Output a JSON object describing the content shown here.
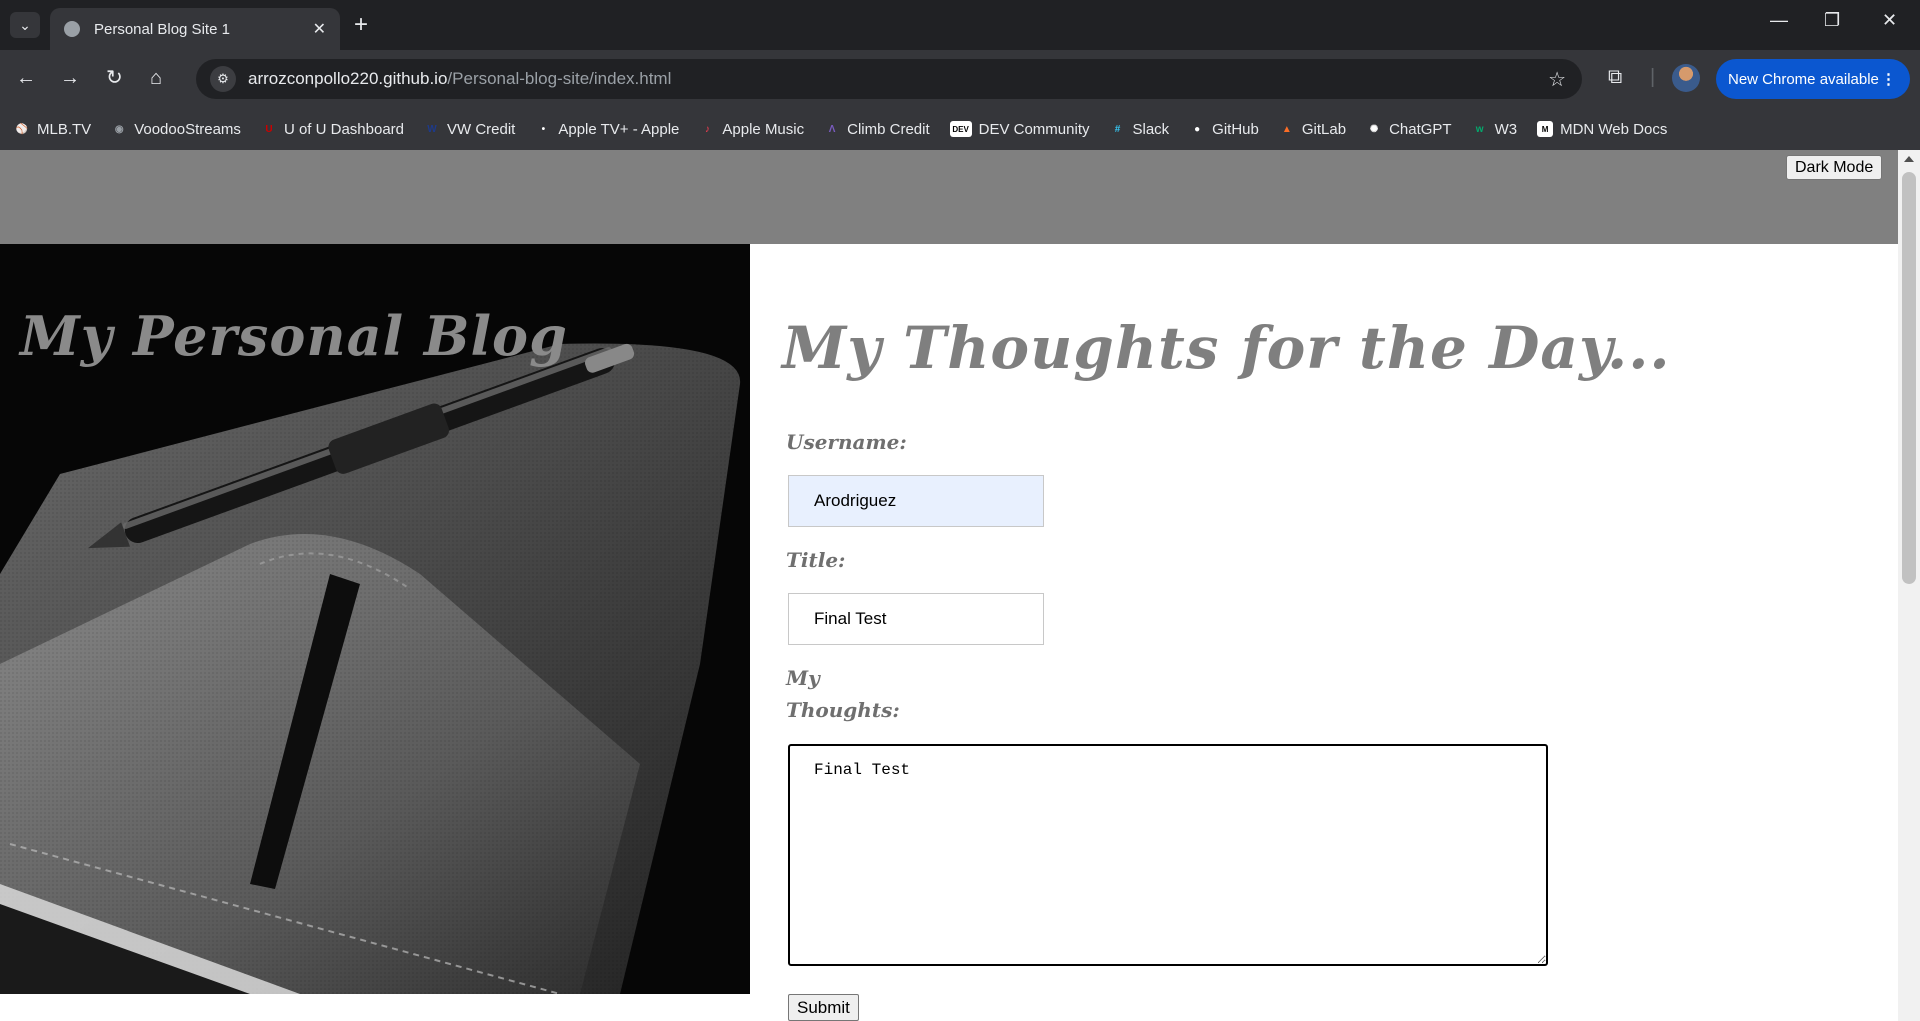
{
  "browser": {
    "tab_title": "Personal Blog Site 1",
    "tab_close": "✕",
    "new_tab": "+",
    "url_domain": "arrozconpollo220.github.io",
    "url_path": "/Personal-blog-site/index.html",
    "update_label": "New Chrome available",
    "update_menu": "⋮"
  },
  "bookmarks": [
    {
      "label": "MLB.TV",
      "icon": "mlb-icon",
      "color": "#0a2a66"
    },
    {
      "label": "VoodooStreams",
      "icon": "voodoo-icon",
      "color": "#9aa0a6"
    },
    {
      "label": "U of U Dashboard",
      "icon": "utah-icon",
      "color": "#cc0000"
    },
    {
      "label": "VW Credit",
      "icon": "vw-icon",
      "color": "#1e3a8a"
    },
    {
      "label": "Apple TV+ - Apple",
      "icon": "apple-icon",
      "color": "#ffffff"
    },
    {
      "label": "Apple Music",
      "icon": "music-icon",
      "color": "#fa3d52"
    },
    {
      "label": "Climb Credit",
      "icon": "climb-icon",
      "color": "#7a5cc0"
    },
    {
      "label": "DEV Community",
      "icon": "dev-icon",
      "color": "#000000"
    },
    {
      "label": "Slack",
      "icon": "slack-icon",
      "color": "#36c5f0"
    },
    {
      "label": "GitHub",
      "icon": "github-icon",
      "color": "#ffffff"
    },
    {
      "label": "GitLab",
      "icon": "gitlab-icon",
      "color": "#fc6d26"
    },
    {
      "label": "ChatGPT",
      "icon": "chatgpt-icon",
      "color": "#ffffff"
    },
    {
      "label": "W3",
      "icon": "w3-icon",
      "color": "#04aa6d"
    },
    {
      "label": "MDN Web Docs",
      "icon": "mdn-icon",
      "color": "#000000"
    }
  ],
  "page": {
    "dark_mode_label": "Dark Mode",
    "hero_title": "My Personal Blog",
    "heading": "My Thoughts for the Day...",
    "username_label": "Username:",
    "username_value": "Arodriguez",
    "title_label": "Title:",
    "title_value": "Final Test",
    "thoughts_label_line1": "My",
    "thoughts_label_line2": "Thoughts:",
    "thoughts_value": "Final Test",
    "submit_label": "Submit"
  }
}
